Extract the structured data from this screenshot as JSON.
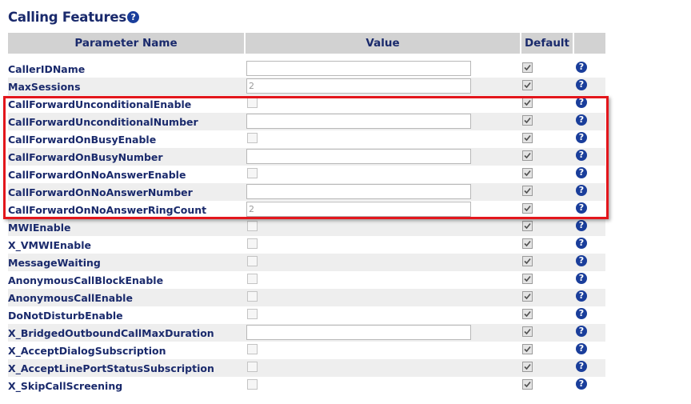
{
  "page": {
    "title": "Calling Features",
    "help_glyph": "?"
  },
  "table": {
    "headers": {
      "parameter": "Parameter Name",
      "value": "Value",
      "default": "Default"
    },
    "rows": [
      {
        "name": "CallerIDName",
        "control": "text",
        "value": ""
      },
      {
        "name": "MaxSessions",
        "control": "text",
        "value": "2"
      },
      {
        "name": "CallForwardUnconditionalEnable",
        "control": "checkbox",
        "value": ""
      },
      {
        "name": "CallForwardUnconditionalNumber",
        "control": "text",
        "value": ""
      },
      {
        "name": "CallForwardOnBusyEnable",
        "control": "checkbox",
        "value": ""
      },
      {
        "name": "CallForwardOnBusyNumber",
        "control": "text",
        "value": ""
      },
      {
        "name": "CallForwardOnNoAnswerEnable",
        "control": "checkbox",
        "value": ""
      },
      {
        "name": "CallForwardOnNoAnswerNumber",
        "control": "text",
        "value": ""
      },
      {
        "name": "CallForwardOnNoAnswerRingCount",
        "control": "text",
        "value": "2"
      },
      {
        "name": "MWIEnable",
        "control": "checkbox",
        "value": ""
      },
      {
        "name": "X_VMWIEnable",
        "control": "checkbox",
        "value": ""
      },
      {
        "name": "MessageWaiting",
        "control": "checkbox",
        "value": ""
      },
      {
        "name": "AnonymousCallBlockEnable",
        "control": "checkbox",
        "value": ""
      },
      {
        "name": "AnonymousCallEnable",
        "control": "checkbox",
        "value": ""
      },
      {
        "name": "DoNotDisturbEnable",
        "control": "checkbox",
        "value": ""
      },
      {
        "name": "X_BridgedOutboundCallMaxDuration",
        "control": "text",
        "value": ""
      },
      {
        "name": "X_AcceptDialogSubscription",
        "control": "checkbox",
        "value": ""
      },
      {
        "name": "X_AcceptLinePortStatusSubscription",
        "control": "checkbox",
        "value": ""
      },
      {
        "name": "X_SkipCallScreening",
        "control": "checkbox",
        "value": ""
      }
    ]
  },
  "colors": {
    "header_bg": "#d2d2d2",
    "text": "#1a2a6c",
    "help_icon": "#1a3e9b",
    "highlight_border": "#e3161c",
    "row_shade": "#eeeeee"
  }
}
